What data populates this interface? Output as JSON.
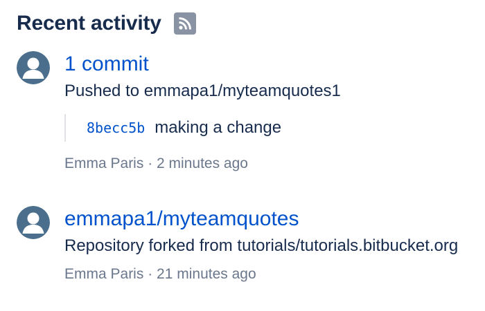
{
  "header": {
    "title": "Recent activity",
    "feed_icon": "rss-feed-icon"
  },
  "activity": [
    {
      "avatar_icon": "user-avatar-icon",
      "title": "1 commit",
      "description": "Pushed to emmapa1/myteamquotes1",
      "commit": {
        "hash": "8becc5b",
        "message": "making a change"
      },
      "author": "Emma Paris",
      "separator": "·",
      "time": "2 minutes ago"
    },
    {
      "avatar_icon": "user-avatar-icon",
      "title": "emmapa1/myteamquotes",
      "description": "Repository forked from tutorials/tutorials.bitbucket.org",
      "author": "Emma Paris",
      "separator": "·",
      "time": "21 minutes ago"
    }
  ],
  "colors": {
    "link": "#0052cc",
    "text": "#172b4d",
    "muted": "#6b778c",
    "avatar_bg": "#4a6e8c",
    "icon_bg": "#8993a4"
  }
}
